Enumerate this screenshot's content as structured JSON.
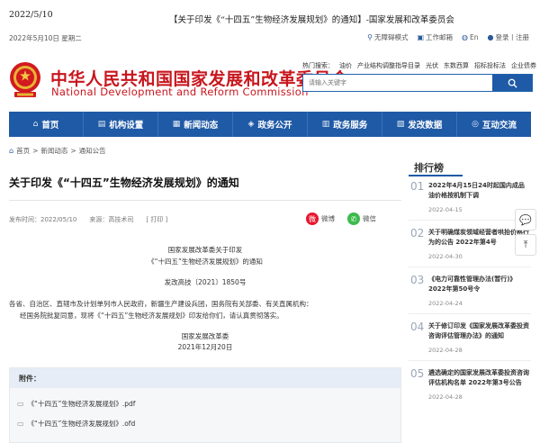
{
  "print_header": {
    "date": "2022/5/10",
    "title": "【关于印发《“十四五”生物经济发展规划》的通知】-国家发展和改革委员会"
  },
  "topbar": {
    "today": "2022年5月10日 星期二",
    "links": [
      {
        "icon": "accessibility-icon",
        "label": "无障碍模式"
      },
      {
        "icon": "mail-icon",
        "label": "工作邮箱"
      },
      {
        "icon": "globe-icon",
        "label": "En"
      },
      {
        "icon": "user-icon",
        "label": "登录丨注册"
      }
    ]
  },
  "brand": {
    "name_cn": "中华人民共和国国家发展和改革委员会",
    "name_en": "National Development and Reform Commission",
    "colors": {
      "primary_red": "#c8161d",
      "nav_blue": "#1f5aa6"
    }
  },
  "hot_search": {
    "label": "热门搜索：",
    "terms": [
      "油价",
      "产业结构调整指导目录",
      "光伏",
      "东数西算",
      "招标投标法",
      "企业债券"
    ]
  },
  "search": {
    "placeholder": "请输入关键字"
  },
  "nav": [
    {
      "icon": "home-icon",
      "label": "首页"
    },
    {
      "icon": "org-icon",
      "label": "机构设置"
    },
    {
      "icon": "news-icon",
      "label": "新闻动态"
    },
    {
      "icon": "public-icon",
      "label": "政务公开"
    },
    {
      "icon": "service-icon",
      "label": "政务服务"
    },
    {
      "icon": "data-icon",
      "label": "发改数据"
    },
    {
      "icon": "chat-icon",
      "label": "互动交流"
    }
  ],
  "breadcrumb": [
    "首页",
    "新闻动态",
    "通知公告"
  ],
  "article": {
    "title": "关于印发《“十四五”生物经济发展规划》的通知",
    "meta": {
      "published": "发布时间：2022/05/10",
      "source": "来源：高技术司",
      "print": "[ 打印 ]"
    },
    "share": [
      {
        "label": "微博",
        "color": "#e6162d"
      },
      {
        "label": "微信",
        "color": "#3dbb4d"
      }
    ],
    "issuer_line1": "国家发展改革委关于印发",
    "issuer_line2": "《“十四五”生物经济发展规划》的通知",
    "doc_number": "发改高技〔2021〕1850号",
    "recipients": "各省、自治区、直辖市及计划单列市人民政府，新疆生产建设兵团，国务院有关部委、有关直属机构：",
    "body": "经国务院批复同意，现将《“十四五”生物经济发展规划》印发给你们，请认真贯彻落实。",
    "signature": "国家发展改革委",
    "sign_date": "2021年12月20日"
  },
  "attachments": {
    "heading": "附件：",
    "files": [
      "《“十四五”生物经济发展规划》.pdf",
      "《“十四五”生物经济发展规划》.ofd"
    ]
  },
  "ranking": {
    "heading": "排行榜",
    "items": [
      {
        "num": "01",
        "title": "2022年4月15日24时起国内成品油价格按机制下调",
        "date": "2022-04-15"
      },
      {
        "num": "02",
        "title": "关于明确煤炭领域经营者哄抬价格行为的公告 2022年第4号",
        "date": "2022-04-30"
      },
      {
        "num": "03",
        "title": "《电力可靠性管理办法(暂行)》2022年第50号令",
        "date": "2022-04-24"
      },
      {
        "num": "04",
        "title": "关于修订印发《国家发展改革委投资咨询评估管理办法》的通知",
        "date": "2022-04-28"
      },
      {
        "num": "05",
        "title": "遴选确定的国家发展改革委投资咨询评估机构名单 2022年第3号公告",
        "date": "2022-04-28"
      }
    ]
  },
  "float_buttons": [
    {
      "icon": "chat-bubble-icon"
    },
    {
      "icon": "back-to-top-icon"
    }
  ]
}
